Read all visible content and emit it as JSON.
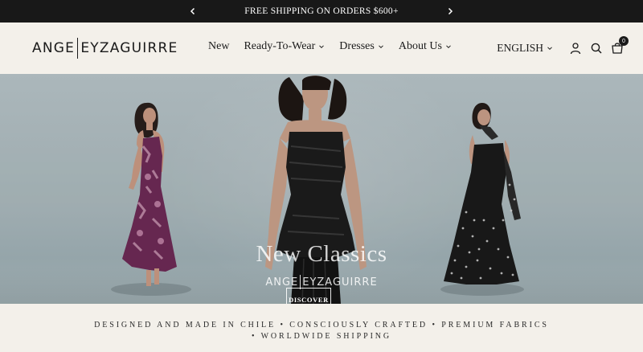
{
  "announcement": {
    "text": "FREE SHIPPING ON ORDERS $600+",
    "prev_icon": "chevron-left-icon",
    "next_icon": "chevron-right-icon"
  },
  "header": {
    "logo": {
      "left": "ANGE",
      "right": "EYZAGUIRRE"
    },
    "nav": [
      {
        "label": "New",
        "has_dropdown": false
      },
      {
        "label": "Ready-To-Wear",
        "has_dropdown": true
      },
      {
        "label": "Dresses",
        "has_dropdown": true
      },
      {
        "label": "About Us",
        "has_dropdown": true
      }
    ],
    "language": "ENGLISH",
    "icons": [
      "user-icon",
      "search-icon",
      "cart-icon"
    ],
    "cart_count": "0"
  },
  "hero": {
    "title": "New Classics",
    "brand": {
      "left": "ANGE",
      "right": "EYZAGUIRRE"
    },
    "cta": "DISCOVER"
  },
  "values_strip": {
    "line1": "DESIGNED AND MADE IN CHILE • CONSCIOUSLY CRAFTED • PREMIUM FABRICS",
    "line2": "• WORLDWIDE SHIPPING"
  },
  "colors": {
    "announcement_bg": "#181818",
    "page_bg": "#f3f0ea",
    "hero_bg": "#aab8bc",
    "dress_left": "#6d2a55",
    "dress_center": "#1c1c1c",
    "dress_right": "#1a1a1a"
  }
}
